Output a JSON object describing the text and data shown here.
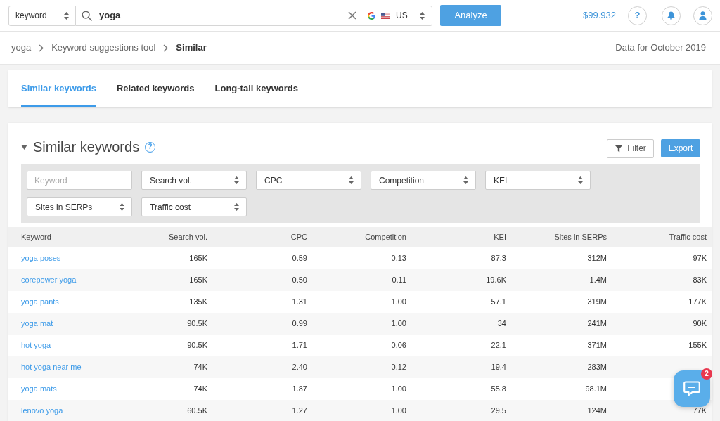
{
  "search_bar": {
    "search_type": "keyword",
    "query": "yoga",
    "country": "US",
    "analyze_button": "Analyze"
  },
  "header_right": {
    "balance": "$99.932",
    "help_button": "?"
  },
  "breadcrumb": [
    {
      "label": "yoga",
      "current": false
    },
    {
      "label": "Keyword suggestions tool",
      "current": false
    },
    {
      "label": "Similar",
      "current": true
    }
  ],
  "data_date": "Data for October 2019",
  "tabs": [
    {
      "label": "Similar keywords",
      "selected": true
    },
    {
      "label": "Related keywords",
      "selected": false
    },
    {
      "label": "Long-tail keywords",
      "selected": false
    }
  ],
  "section": {
    "title": "Similar keywords",
    "expanded": true,
    "help": "?",
    "filter_button": "Filter",
    "export_button": "Export"
  },
  "filters": [
    {
      "kind": "text",
      "placeholder": "Keyword"
    },
    {
      "kind": "select",
      "value": "Search vol."
    },
    {
      "kind": "select",
      "value": "CPC"
    },
    {
      "kind": "select",
      "value": "Competition"
    },
    {
      "kind": "select",
      "value": "KEI"
    },
    {
      "kind": "select",
      "value": "Sites in SERPs"
    },
    {
      "kind": "select",
      "value": "Traffic cost"
    }
  ],
  "table": {
    "columns": [
      "Keyword",
      "Search vol.",
      "CPC",
      "Competition",
      "KEI",
      "Sites in SERPs",
      "Traffic cost"
    ],
    "rows": [
      {
        "cells": [
          "yoga poses",
          "165K",
          "0.59",
          "0.13",
          "87.3",
          "312M",
          "97K"
        ]
      },
      {
        "cells": [
          "corepower yoga",
          "165K",
          "0.50",
          "0.11",
          "19.6K",
          "1.4M",
          "83K"
        ]
      },
      {
        "cells": [
          "yoga pants",
          "135K",
          "1.31",
          "1.00",
          "57.1",
          "319M",
          "177K"
        ]
      },
      {
        "cells": [
          "yoga mat",
          "90.5K",
          "0.99",
          "1.00",
          "34",
          "241M",
          "90K"
        ]
      },
      {
        "cells": [
          "hot yoga",
          "90.5K",
          "1.71",
          "0.06",
          "22.1",
          "371M",
          "155K"
        ]
      },
      {
        "cells": [
          "hot yoga near me",
          "74K",
          "2.40",
          "0.12",
          "19.4",
          "283M"
        ]
      },
      {
        "cells": [
          "yoga mats",
          "74K",
          "1.87",
          "1.00",
          "55.8",
          "98.1M"
        ]
      },
      {
        "cells": [
          "lenovo yoga",
          "60.5K",
          "1.27",
          "1.00",
          "29.5",
          "124M",
          "77K"
        ]
      }
    ]
  },
  "chat": {
    "badge": "2"
  }
}
